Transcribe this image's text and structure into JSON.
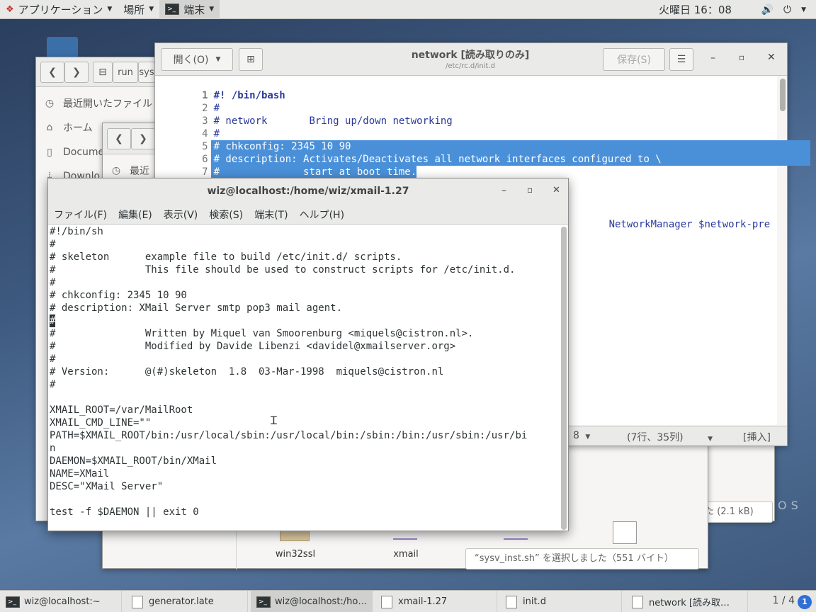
{
  "topbar": {
    "apps_label": "アプリケーション",
    "places_label": "場所",
    "terminal_label": "端末",
    "clock": "火曜日 16：08"
  },
  "files_back": {
    "path_run": "run",
    "path_sys": "sys",
    "sidebar": [
      "最近開いたファイル",
      "ホーム",
      "Docume",
      "Downlo"
    ],
    "status": "“xmail” を選択しました (2.1 kB)"
  },
  "files_front": {
    "sidebar_recent": "最近",
    "items": [
      "win32ssl",
      "xmail"
    ],
    "status": "“sysv_inst.sh” を選択しました（551 バイト）"
  },
  "gedit": {
    "open_label": "開く(O)",
    "save_label": "保存(S)",
    "title": "network [読み取りのみ]",
    "subtitle": "/etc/rc.d/init.d",
    "lines": [
      {
        "n": "1",
        "t": "#! /bin/bash"
      },
      {
        "n": "2",
        "t": "#"
      },
      {
        "n": "3",
        "t": "# network       Bring up/down networking"
      },
      {
        "n": "4",
        "t": "#"
      },
      {
        "n": "5",
        "t": "# chkconfig: 2345 10 90"
      },
      {
        "n": "6",
        "t": "# description: Activates/Deactivates all network interfaces configured to \\"
      },
      {
        "n": "7",
        "t": "#              start at boot time."
      },
      {
        "n": "8",
        "t": "#"
      }
    ],
    "visible_fragment": "NetworkManager $network-pre",
    "tab_width": "8",
    "position": "(7行、35列)",
    "mode": "[挿入]"
  },
  "terminal": {
    "title": "wiz@localhost:/home/wiz/xmail-1.27",
    "menu": [
      "ファイル(F)",
      "編集(E)",
      "表示(V)",
      "検索(S)",
      "端末(T)",
      "ヘルプ(H)"
    ],
    "lines": [
      "#!/bin/sh",
      "#",
      "# skeleton      example file to build /etc/init.d/ scripts.",
      "#               This file should be used to construct scripts for /etc/init.d.",
      "#",
      "# chkconfig: 2345 10 90",
      "# description: XMail Server smtp pop3 mail agent.",
      "#",
      "#               Written by Miquel van Smoorenburg <miquels@cistron.nl>.",
      "#               Modified by Davide Libenzi <davidel@xmailserver.org>",
      "#",
      "# Version:      @(#)skeleton  1.8  03-Mar-1998  miquels@cistron.nl",
      "#",
      "",
      "XMAIL_ROOT=/var/MailRoot",
      "XMAIL_CMD_LINE=\"\"",
      "PATH=$XMAIL_ROOT/bin:/usr/local/sbin:/usr/local/bin:/sbin:/bin:/usr/sbin:/usr/bi",
      "n",
      "DAEMON=$XMAIL_ROOT/bin/XMail",
      "NAME=XMail",
      "DESC=\"XMail Server\"",
      "",
      "test -f $DAEMON || exit 0"
    ]
  },
  "taskbar": {
    "tasks": [
      "wiz@localhost:~",
      "generator.late",
      "wiz@localhost:/ho…",
      "xmail-1.27",
      "init.d",
      "network [読み取…"
    ],
    "workspace": "1 / 4",
    "indicator": "1"
  },
  "desktop": {
    "watermark": "OS"
  }
}
